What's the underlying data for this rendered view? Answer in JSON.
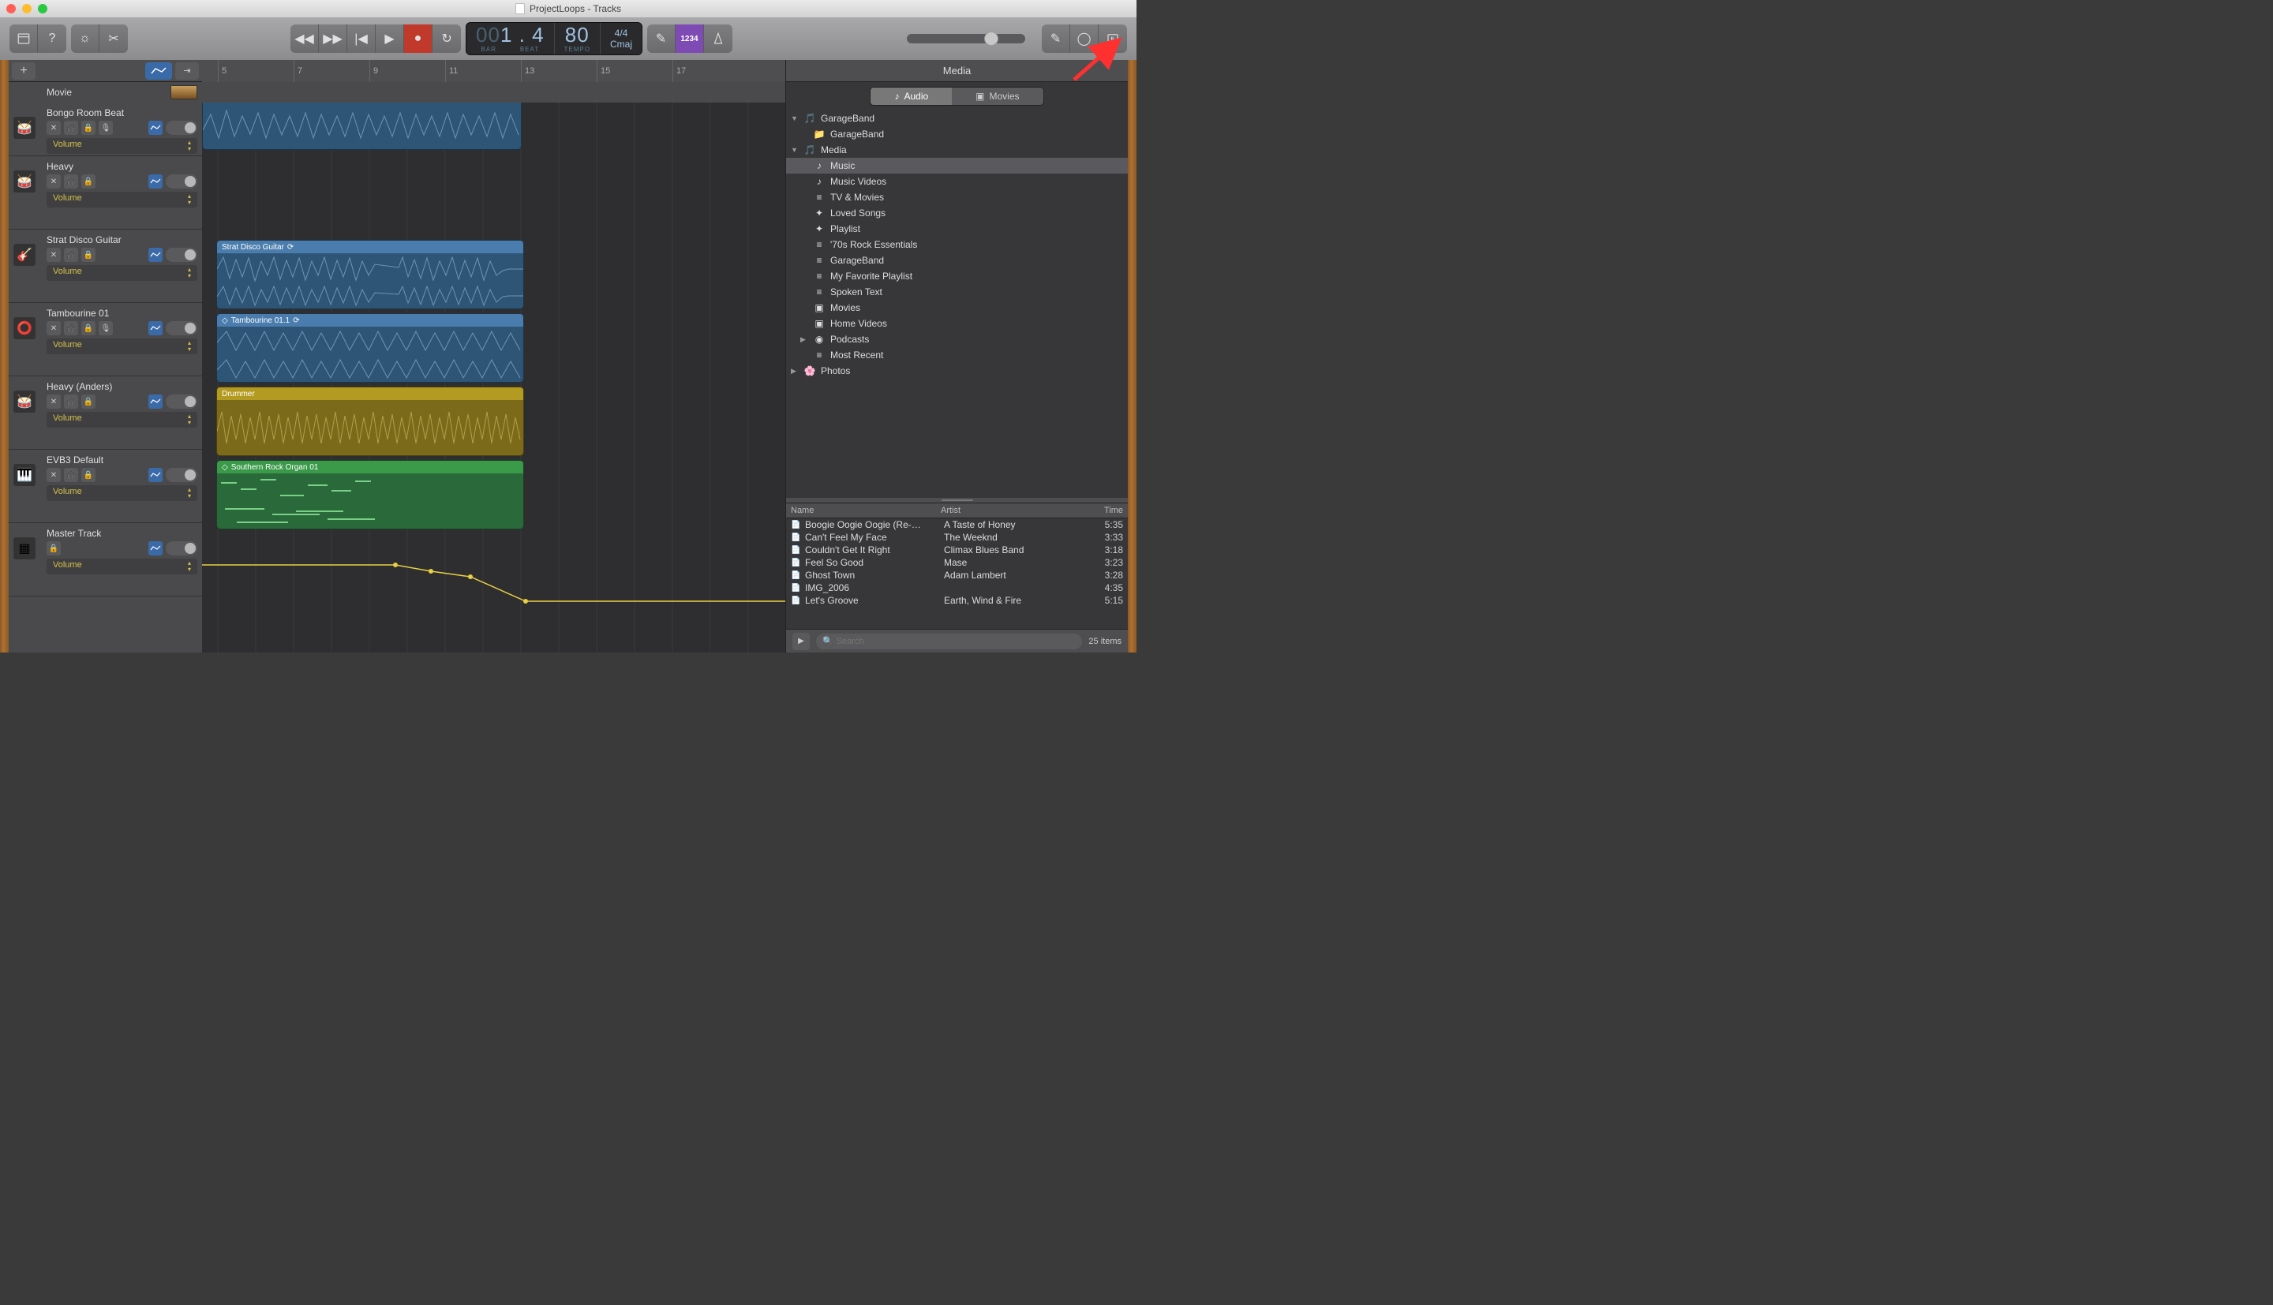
{
  "window": {
    "title": "ProjectLoops - Tracks"
  },
  "lcd": {
    "bar_dim": "00",
    "beat": "1 . 4",
    "tempo": "80",
    "sig": "4/4",
    "key": "Cmaj",
    "lbl_bar": "BAR",
    "lbl_beat": "BEAT",
    "lbl_tempo": "TEMPO"
  },
  "countin": "1234",
  "ruler": {
    "marks": [
      5,
      7,
      9,
      11,
      13,
      15,
      17
    ]
  },
  "movie_label": "Movie",
  "tracks": [
    {
      "name": "Bongo Room Beat",
      "vol": "Volume",
      "icon": "🥁"
    },
    {
      "name": "Heavy",
      "vol": "Volume",
      "icon": "🥁"
    },
    {
      "name": "Strat Disco Guitar",
      "vol": "Volume",
      "icon": "🎸"
    },
    {
      "name": "Tambourine 01",
      "vol": "Volume",
      "icon": "⭕"
    },
    {
      "name": "Heavy (Anders)",
      "vol": "Volume",
      "icon": "🥁"
    },
    {
      "name": "EVB3 Default",
      "vol": "Volume",
      "icon": "🎹"
    },
    {
      "name": "Master Track",
      "vol": "Volume",
      "icon": "▦"
    }
  ],
  "regions": {
    "r1_label": "Strat Disco Guitar",
    "r2_label": "Tambourine 01.1",
    "r3_label": "Drummer",
    "r4_label": "Southern Rock Organ 01"
  },
  "media": {
    "title": "Media",
    "tab_audio": "Audio",
    "tab_movies": "Movies",
    "tree": [
      {
        "lvl": 0,
        "open": "▼",
        "icon": "🎵",
        "label": "GarageBand"
      },
      {
        "lvl": 1,
        "open": "",
        "icon": "📁",
        "label": "GarageBand"
      },
      {
        "lvl": 0,
        "open": "▼",
        "icon": "🎵",
        "label": "Media"
      },
      {
        "lvl": 1,
        "open": "",
        "icon": "♪",
        "label": "Music",
        "sel": true
      },
      {
        "lvl": 1,
        "open": "",
        "icon": "♪",
        "label": "Music Videos"
      },
      {
        "lvl": 1,
        "open": "",
        "icon": "≡",
        "label": "TV & Movies"
      },
      {
        "lvl": 1,
        "open": "",
        "icon": "✦",
        "label": "Loved Songs"
      },
      {
        "lvl": 1,
        "open": "",
        "icon": "✦",
        "label": "Playlist"
      },
      {
        "lvl": 1,
        "open": "",
        "icon": "≡",
        "label": "'70s Rock Essentials"
      },
      {
        "lvl": 1,
        "open": "",
        "icon": "≡",
        "label": "GarageBand"
      },
      {
        "lvl": 1,
        "open": "",
        "icon": "≡",
        "label": "My Favorite Playlist"
      },
      {
        "lvl": 1,
        "open": "",
        "icon": "≡",
        "label": "Spoken Text"
      },
      {
        "lvl": 1,
        "open": "",
        "icon": "▣",
        "label": "Movies"
      },
      {
        "lvl": 1,
        "open": "",
        "icon": "▣",
        "label": "Home Videos"
      },
      {
        "lvl": 1,
        "open": "▶",
        "icon": "◉",
        "label": "Podcasts"
      },
      {
        "lvl": 1,
        "open": "",
        "icon": "≡",
        "label": "Most Recent"
      },
      {
        "lvl": 0,
        "open": "▶",
        "icon": "🌸",
        "label": "Photos"
      }
    ],
    "cols": {
      "name": "Name",
      "artist": "Artist",
      "time": "Time"
    },
    "songs": [
      {
        "name": "Boogie Oogie Oogie (Re-…",
        "artist": "A Taste of Honey",
        "time": "5:35"
      },
      {
        "name": "Can't Feel My Face",
        "artist": "The Weeknd",
        "time": "3:33"
      },
      {
        "name": "Couldn't Get It Right",
        "artist": "Climax Blues Band",
        "time": "3:18"
      },
      {
        "name": "Feel So Good",
        "artist": "Mase",
        "time": "3:23"
      },
      {
        "name": "Ghost Town",
        "artist": "Adam Lambert",
        "time": "3:28"
      },
      {
        "name": "IMG_2006",
        "artist": "",
        "time": "4:35"
      },
      {
        "name": "Let's Groove",
        "artist": "Earth, Wind & Fire",
        "time": "5:15"
      }
    ],
    "search_placeholder": "Search",
    "item_count": "25 items"
  }
}
